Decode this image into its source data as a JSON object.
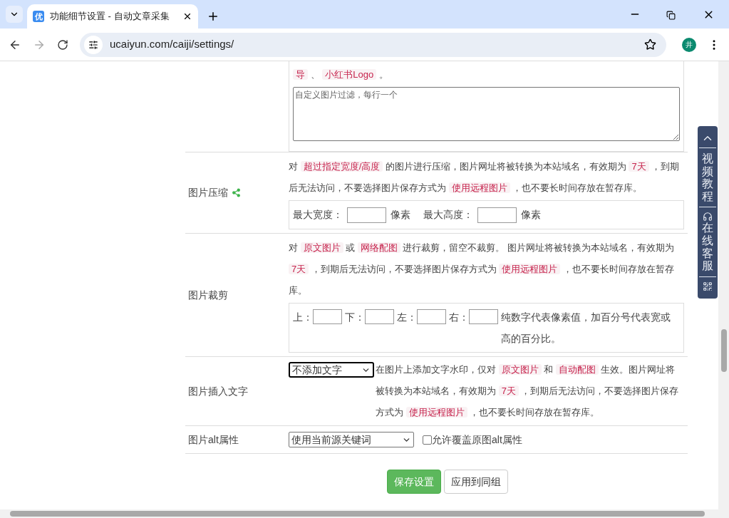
{
  "browser": {
    "favicon_text": "优",
    "tab_title": "功能细节设置 - 自动文章采集",
    "url": "ucaiyun.com/caiji/settings/",
    "profile_initial": "井"
  },
  "rows": [
    {
      "kind": "textarea",
      "description": [
        {
          "t": "导",
          "code": true
        },
        {
          "t": " 、 ",
          "code": false
        },
        {
          "t": "小红书Logo",
          "code": true
        },
        {
          "t": " 。",
          "code": false
        }
      ],
      "placeholder": "自定义图片过滤，每行一个"
    },
    {
      "kind": "size",
      "label": "图片压缩",
      "description": [
        {
          "t": "对 ",
          "code": false
        },
        {
          "t": "超过指定宽度/高度",
          "code": true
        },
        {
          "t": " 的图片进行压缩，图片网址将被转换为本站域名，有效期为 ",
          "code": false
        },
        {
          "t": "7天",
          "code": true
        },
        {
          "t": " ，到期后无法访问，不要选择图片保存方式为 ",
          "code": false
        },
        {
          "t": "使用远程图片",
          "code": true
        },
        {
          "t": " ，也不要长时间存放在暂存库。",
          "code": false
        }
      ],
      "fields": [
        {
          "label": "最大宽度：",
          "unit": "像素"
        },
        {
          "label": "最大高度：",
          "unit": "像素"
        }
      ]
    },
    {
      "kind": "crop",
      "label": "图片裁剪",
      "description": [
        {
          "t": "对 ",
          "code": false
        },
        {
          "t": "原文图片",
          "code": true
        },
        {
          "t": " 或 ",
          "code": false
        },
        {
          "t": "网络配图",
          "code": true
        },
        {
          "t": " 进行裁剪，留空不裁剪。 图片网址将被转换为本站域名，有效期为 ",
          "code": false
        },
        {
          "t": "7天",
          "code": true
        },
        {
          "t": " ，到期后无法访问，不要选择图片保存方式为 ",
          "code": false
        },
        {
          "t": "使用远程图片",
          "code": true
        },
        {
          "t": " ，也不要长时间存放在暂存库。",
          "code": false
        }
      ],
      "fields": [
        {
          "label": "上："
        },
        {
          "label": "下："
        },
        {
          "label": "左："
        },
        {
          "label": "右："
        }
      ],
      "note": "纯数字代表像素值，加百分号代表宽或高的百分比。"
    },
    {
      "kind": "select_desc",
      "label": "图片插入文字",
      "select": "不添加文字",
      "focused": true,
      "description": [
        {
          "t": " 在图片上添加文字水印，仅对 ",
          "code": false
        },
        {
          "t": "原文图片",
          "code": true
        },
        {
          "t": " 和 ",
          "code": false
        },
        {
          "t": "自动配图",
          "code": true
        },
        {
          "t": " 生效。图片网址将被转换为本站域名，有效期为 ",
          "code": false
        },
        {
          "t": "7天",
          "code": true
        },
        {
          "t": " ，到期后无法访问，不要选择图片保存方式为 ",
          "code": false
        },
        {
          "t": "使用远程图片",
          "code": true
        },
        {
          "t": " ，也不要长时间存放在暂存库。",
          "code": false
        }
      ]
    },
    {
      "kind": "select_check",
      "label": "图片alt属性",
      "select": "使用当前源关键词",
      "focused": false,
      "checkbox": {
        "label": "允许覆盖原图alt属性",
        "checked": false
      }
    }
  ],
  "buttons": [
    {
      "label": "保存设置",
      "kind": "primary"
    },
    {
      "label": "应用到同组",
      "kind": "default"
    }
  ],
  "side_widget": [
    {
      "kind": "top"
    },
    {
      "kind": "video",
      "label": "视频教程"
    },
    {
      "kind": "service",
      "label": "在线客服"
    },
    {
      "kind": "qr"
    }
  ]
}
